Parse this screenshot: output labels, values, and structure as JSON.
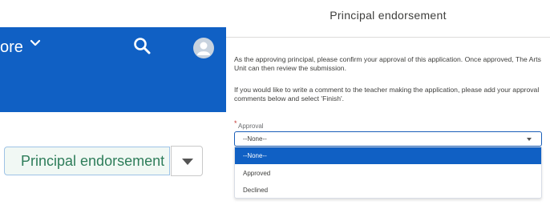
{
  "background": {
    "nav": {
      "more_label": "ore",
      "accent": "#1060c4"
    },
    "endorse_button_label": "Principal endorsement"
  },
  "modal": {
    "title": "Principal endorsement",
    "paragraph1": "As the approving principal, please confirm your approval of this application. Once approved, The Arts Unit can then review the submission.",
    "paragraph2": "If you would like to write a comment to the teacher making the application, please add your approval comments below and select 'Finish'.",
    "approval": {
      "required_marker": "*",
      "label": "Approval",
      "selected_value": "--None--",
      "options": [
        "--None--",
        "Approved",
        "Declined"
      ],
      "highlighted_index": 0
    }
  },
  "icons": [
    "chevron-down-icon",
    "search-icon",
    "avatar-icon",
    "dropdown-caret-icon"
  ],
  "colors": {
    "brand_blue": "#1060c4",
    "button_text_green": "#2e7d5a",
    "required_red": "#c23934"
  }
}
